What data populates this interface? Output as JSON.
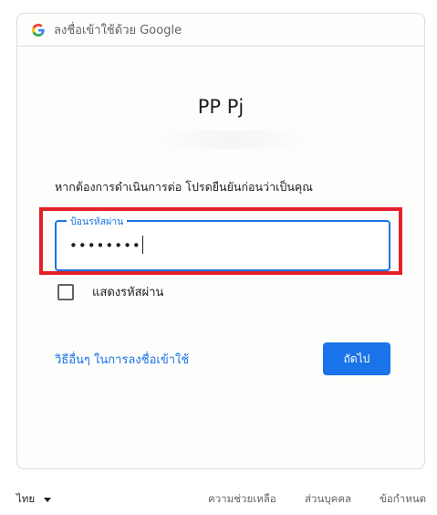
{
  "header": {
    "title": "ลงชื่อเข้าใช้ด้วย Google"
  },
  "account": {
    "name": "PP Pj"
  },
  "instruction": "หากต้องการดำเนินการต่อ โปรดยืนยันก่อนว่าเป็นคุณ",
  "password_field": {
    "label": "ป้อนรหัสผ่าน",
    "value": "••••••••"
  },
  "show_password": {
    "label": "แสดงรหัสผ่าน",
    "checked": false
  },
  "other_ways_link": "วิธีอื่นๆ ในการลงชื่อเข้าใช้",
  "next_button": "ถัดไป",
  "footer": {
    "language": "ไทย",
    "help": "ความช่วยเหลือ",
    "privacy": "ส่วนบุคคล",
    "terms": "ข้อกำหนด"
  },
  "colors": {
    "accent": "#1a73e8",
    "highlight": "#e3202a"
  },
  "icons": {
    "header_logo": "google-g-icon",
    "language_dropdown": "caret-down-icon"
  }
}
